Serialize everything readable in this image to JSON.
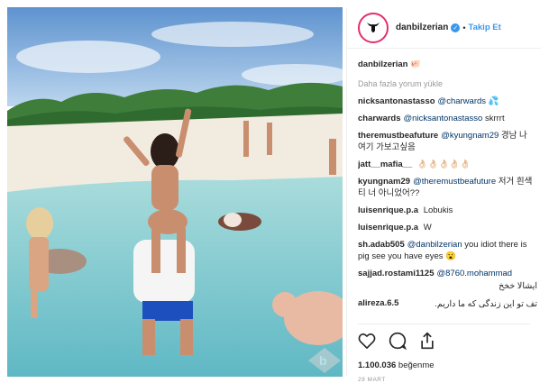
{
  "header": {
    "username": "danbilzerian",
    "verified_icon": "verified-badge-icon",
    "separator": "•",
    "follow_label": "Takip Et"
  },
  "caption": {
    "username": "danbilzerian",
    "emoji": "🐖"
  },
  "load_more_label": "Daha fazla yorum yükle",
  "comments": [
    {
      "user": "nicksantonastasso",
      "mention": "@charwards",
      "text": "💦"
    },
    {
      "user": "charwards",
      "mention": "@nicksantonastasso",
      "text": "skrrrt"
    },
    {
      "user": "theremustbeafuture",
      "mention": "@kyungnam29",
      "text": "경남 나 여기 가보고싶음"
    },
    {
      "user": "jatt__mafia__",
      "mention": "",
      "text": "👌🏻👌🏻👌🏻👌🏻👌🏻"
    },
    {
      "user": "kyungnam29",
      "mention": "@theremustbeafuture",
      "text": "저거 흰색티 너 아니었어??"
    },
    {
      "user": "luisenrique.p.a",
      "mention": "",
      "text": "Lobukis"
    },
    {
      "user": "luisenrique.p.a",
      "mention": "",
      "text": "W"
    },
    {
      "user": "sh.adab505",
      "mention": "@danbilzerian",
      "text": "you idiot there is pig see you have eyes 😮"
    },
    {
      "user": "sajjad.rostami1125",
      "mention": "@8760.mohammad",
      "text": "ایشالا خخخ"
    },
    {
      "user": "alireza.6.5",
      "mention": "",
      "text": "تف تو این زندگی که ما داریم."
    }
  ],
  "actions": {
    "like_icon": "heart-icon",
    "comment_icon": "comment-bubble-icon",
    "share_icon": "share-icon"
  },
  "likes": {
    "count": "1.100.036",
    "label": "beğenme"
  },
  "date": "29 MART",
  "photo": {
    "description_icon": "photo-beach-pigs",
    "watermark_icon": "watermark-logo-icon"
  }
}
